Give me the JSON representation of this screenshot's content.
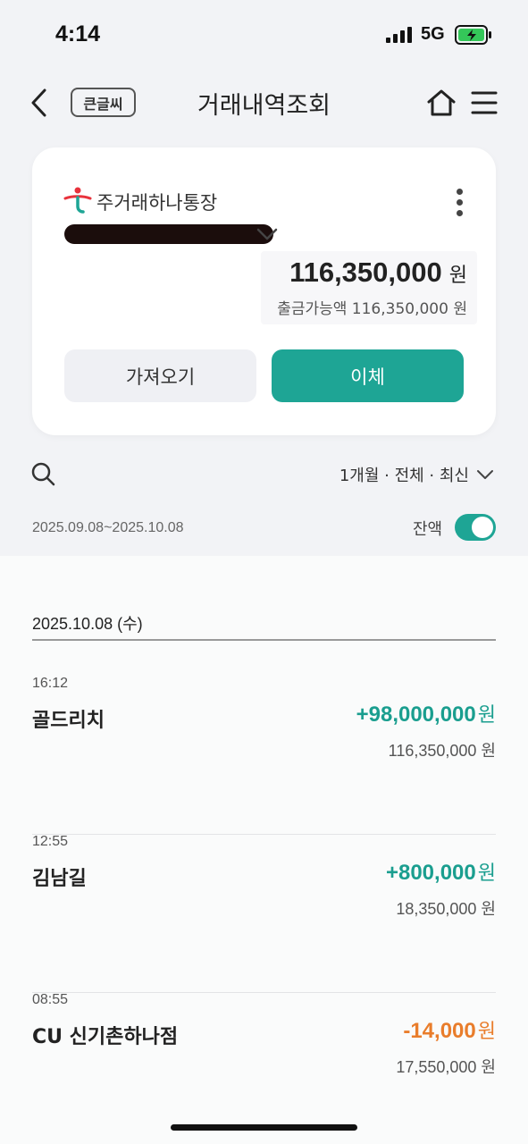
{
  "status_bar": {
    "time": "4:14",
    "network": "5G"
  },
  "header": {
    "big_font_label": "큰글씨",
    "title": "거래내역조회"
  },
  "account": {
    "name": "주거래하나통장",
    "balance": "116,350,000",
    "currency_unit": "원",
    "available_text": "출금가능액 116,350,000 원",
    "fetch_label": "가져오기",
    "transfer_label": "이체"
  },
  "filter": {
    "label": "1개월 · 전체 · 최신",
    "date_range": "2025.09.08~2025.10.08",
    "balance_toggle_label": "잔액",
    "balance_toggle_on": true
  },
  "day": {
    "label": "2025.10.08 (수)"
  },
  "transactions": [
    {
      "time": "16:12",
      "name": "골드리치",
      "amount": "+98,000,000",
      "unit": "원",
      "type": "plus",
      "balance": "116,350,000 원"
    },
    {
      "time": "12:55",
      "name": "김남길",
      "amount": "+800,000",
      "unit": "원",
      "type": "plus",
      "balance": "18,350,000 원"
    },
    {
      "time": "08:55",
      "name": "CU 신기촌하나점",
      "amount": "-14,000",
      "unit": "원",
      "type": "minus",
      "balance": "17,550,000 원"
    }
  ],
  "colors": {
    "accent": "#1ea595",
    "deposit": "#1a9e8f",
    "withdrawal": "#e97d2b"
  }
}
